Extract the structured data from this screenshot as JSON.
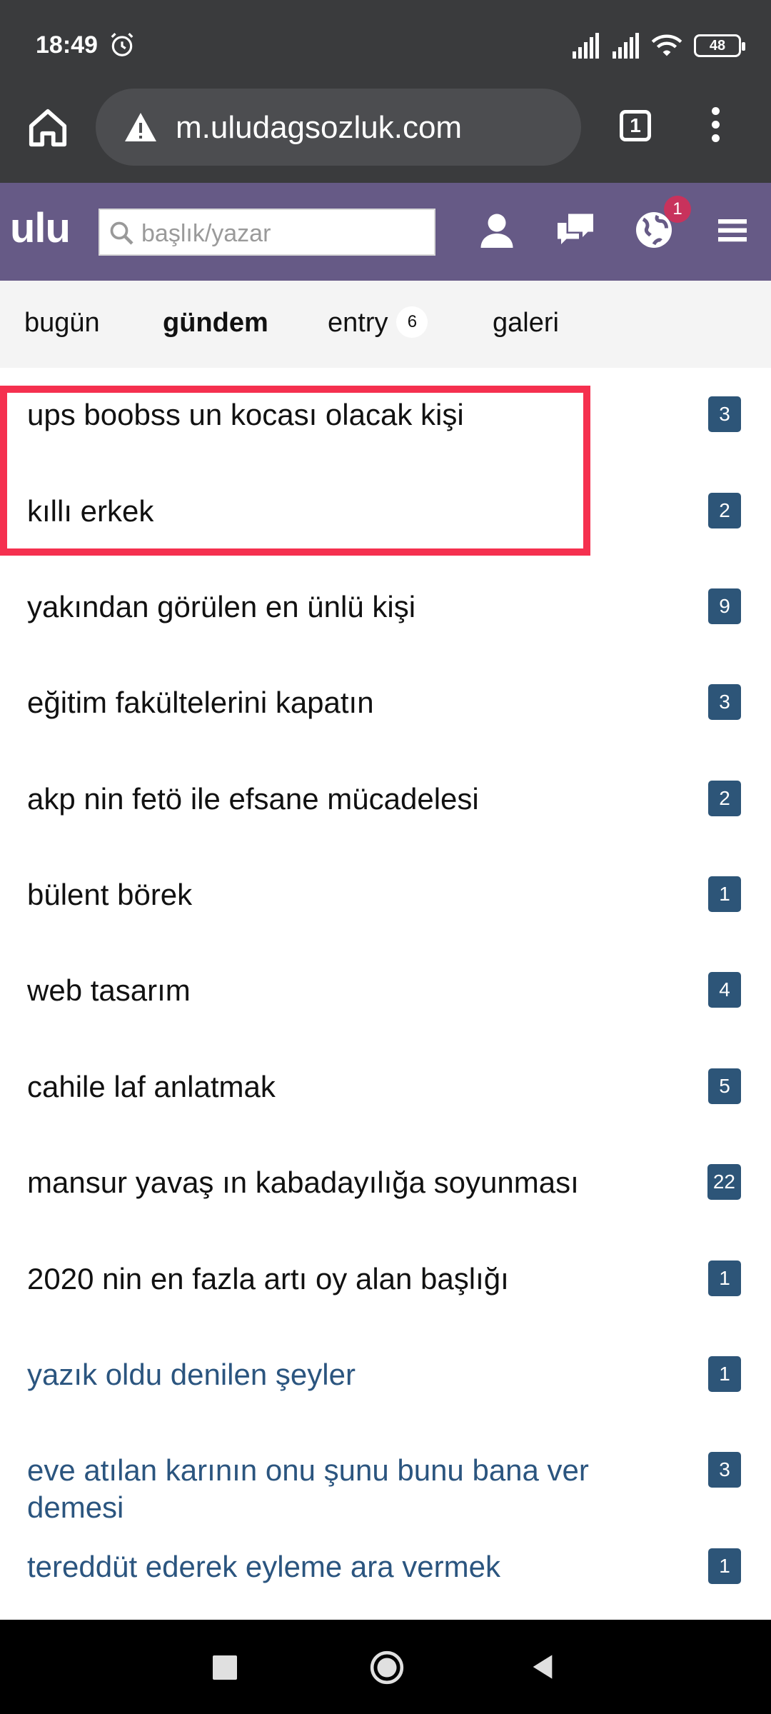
{
  "status_bar": {
    "time": "18:49",
    "battery": "48",
    "icons": [
      "alarm-icon",
      "signal-icon",
      "signal-icon",
      "wifi-icon",
      "battery-icon"
    ]
  },
  "browser": {
    "url": "m.uludagsozluk.com",
    "tab_count": "1",
    "icons": [
      "home-icon",
      "warning-icon",
      "tabs-icon",
      "more-vert-icon"
    ]
  },
  "header": {
    "logo": "ulu",
    "search_placeholder": "başlık/yazar",
    "notification_count": "1",
    "icons": [
      "search-icon",
      "user-icon",
      "messages-icon",
      "globe-icon",
      "hamburger-menu-icon"
    ]
  },
  "tabs": [
    {
      "label": "bugün",
      "active": false
    },
    {
      "label": "gündem",
      "active": true
    },
    {
      "label": "entry",
      "count": "6",
      "active": false
    },
    {
      "label": "galeri",
      "active": false
    }
  ],
  "topics": [
    {
      "title": "ups boobss un kocası olacak kişi",
      "count": "3",
      "visited": false
    },
    {
      "title": "kıllı erkek",
      "count": "2",
      "visited": false
    },
    {
      "title": "yakından görülen en ünlü kişi",
      "count": "9",
      "visited": false
    },
    {
      "title": "eğitim fakültelerini kapatın",
      "count": "3",
      "visited": false
    },
    {
      "title": "akp nin fetö ile efsane mücadelesi",
      "count": "2",
      "visited": false
    },
    {
      "title": "bülent börek",
      "count": "1",
      "visited": false
    },
    {
      "title": "web tasarım",
      "count": "4",
      "visited": false
    },
    {
      "title": "cahile laf anlatmak",
      "count": "5",
      "visited": false
    },
    {
      "title": "mansur yavaş ın kabadayılığa soyunması",
      "count": "22",
      "visited": false
    },
    {
      "title": "2020 nin en fazla artı oy alan başlığı",
      "count": "1",
      "visited": false
    },
    {
      "title": "yazık oldu denilen şeyler",
      "count": "1",
      "visited": true
    },
    {
      "title": "eve atılan karının onu şunu bunu bana ver demesi",
      "count": "3",
      "visited": true
    },
    {
      "title": "tereddüt ederek eyleme ara vermek",
      "count": "1",
      "visited": true
    }
  ],
  "colors": {
    "header_bg": "#665a86",
    "count_badge": "#2d5578",
    "visited_link": "#2b557f",
    "highlight": "#f5304f"
  },
  "nav_bar": {
    "icons": [
      "recents-icon",
      "home-circle-icon",
      "back-icon"
    ]
  }
}
